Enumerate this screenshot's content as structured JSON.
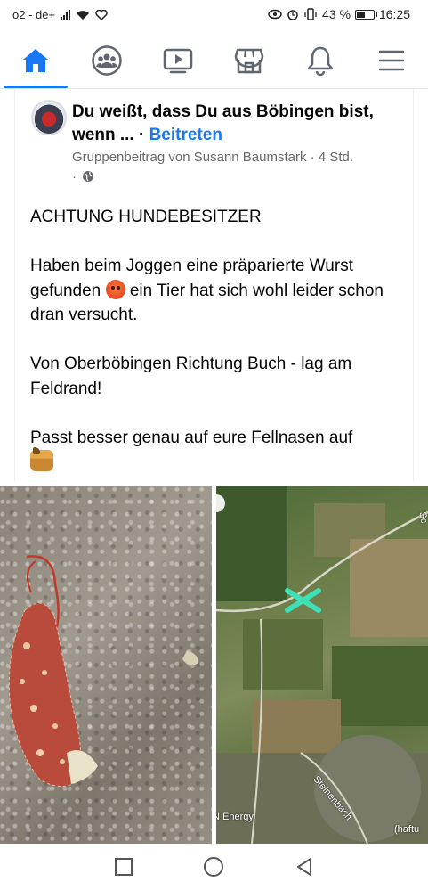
{
  "status_bar": {
    "carrier": "o2 - de+",
    "battery_percent": "43 %",
    "time": "16:25",
    "battery_level": 0.43
  },
  "nav": {
    "items": [
      {
        "icon": "home-icon",
        "active": true
      },
      {
        "icon": "groups-icon",
        "active": false
      },
      {
        "icon": "watch-icon",
        "active": false
      },
      {
        "icon": "marketplace-icon",
        "active": false
      },
      {
        "icon": "notifications-icon",
        "active": false
      },
      {
        "icon": "menu-icon",
        "active": false
      }
    ],
    "accent_color": "#1877f2"
  },
  "post": {
    "group_name": "Du weißt, dass Du aus Böbingen bist, wenn ...",
    "join_label": "Beitreten",
    "meta": "Gruppenbeitrag von Susann Baumstark · 4 Std.",
    "meta_suffix": "·",
    "paragraphs": [
      "ACHTUNG HUNDEBESITZER",
      "Haben beim Joggen eine präparierte Wurst gefunden",
      "ein Tier hat sich wohl leider schon dran versucht.",
      "Von Oberböbingen Richtung Buch - lag am Feldrand!",
      "Passt besser genau auf eure Fellnasen auf"
    ]
  },
  "map": {
    "labels": [
      "N Energy",
      "Steinenbach",
      "(haftu",
      "Sc"
    ]
  },
  "system_nav": {
    "buttons": [
      "recents-button",
      "home-button",
      "back-button"
    ]
  }
}
